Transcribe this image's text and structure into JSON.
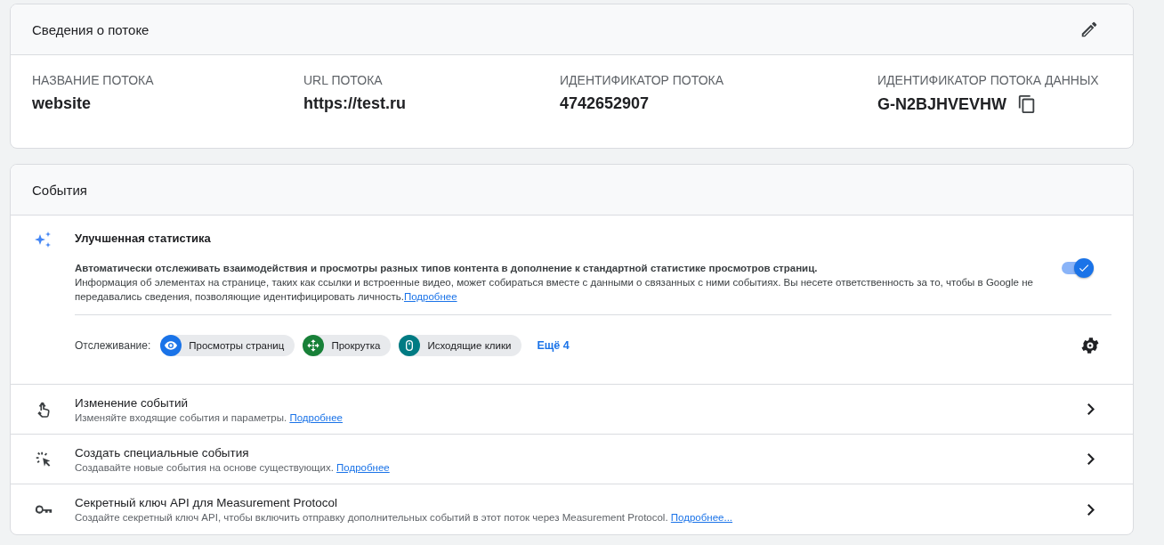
{
  "stream_details": {
    "title": "Сведения о потоке",
    "fields": [
      {
        "label": "НАЗВАНИЕ ПОТОКА",
        "value": "website",
        "copyable": false
      },
      {
        "label": "URL ПОТОКА",
        "value": "https://test.ru",
        "copyable": false
      },
      {
        "label": "ИДЕНТИФИКАТОР ПОТОКА",
        "value": "4742652907",
        "copyable": false
      },
      {
        "label": "ИДЕНТИФИКАТОР ПОТОКА ДАННЫХ",
        "value": "G-N2BJHVEVHW",
        "copyable": true
      }
    ]
  },
  "events": {
    "title": "События",
    "enhanced": {
      "title": "Улучшенная статистика",
      "on": true,
      "lead": "Автоматически отслеживать взаимодействия и просмотры разных типов контента в дополнение к стандартной статистике просмотров страниц.",
      "info": "Информация об элементах на странице, таких как ссылки и встроенные видео, может собираться вместе с данными о связанных с ними событиях. Вы несете ответственность за то, чтобы в Google не передавались сведения, позволяющие идентифицировать личность.",
      "link": "Подробнее",
      "tracking_label": "Отслеживание:",
      "chips": [
        {
          "label": "Просмотры страниц",
          "color": "#1a73e8"
        },
        {
          "label": "Прокрутка",
          "color": "#188038"
        },
        {
          "label": "Исходящие клики",
          "color": "#007b83"
        }
      ],
      "more": "Ещё 4"
    },
    "rows": [
      {
        "title": "Изменение событий",
        "description": "Изменяйте входящие события и параметры.",
        "link": "Подробнее"
      },
      {
        "title": "Создать специальные события",
        "description": "Создавайте новые события на основе существующих.",
        "link": "Подробнее"
      },
      {
        "title": "Секретный ключ API для Measurement Protocol",
        "description": "Создайте секретный ключ API, чтобы включить отправку дополнительных событий в этот поток через Measurement Protocol.",
        "link": "Подробнее..."
      }
    ]
  }
}
